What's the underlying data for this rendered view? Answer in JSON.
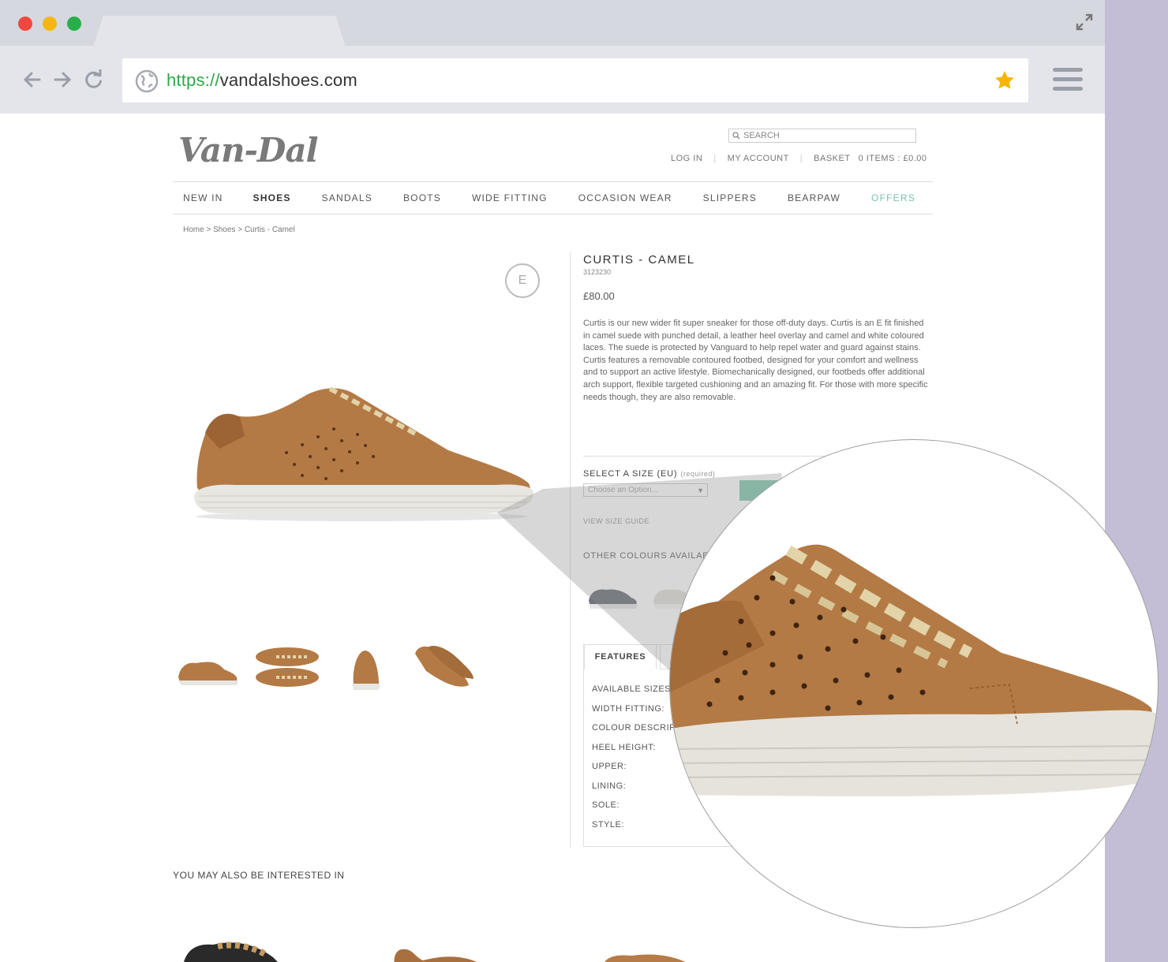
{
  "browser": {
    "url_protocol": "https://",
    "url_host": "vandalshoes.com"
  },
  "header": {
    "logo": "Van-Dal",
    "search_placeholder": "SEARCH",
    "login": "LOG IN",
    "account": "MY ACCOUNT",
    "basket": "BASKET",
    "basket_summary": "0 ITEMS : £0.00"
  },
  "nav": {
    "items": [
      "NEW IN",
      "SHOES",
      "SANDALS",
      "BOOTS",
      "WIDE FITTING",
      "OCCASION WEAR",
      "SLIPPERS",
      "BEARPAW",
      "OFFERS"
    ],
    "active": "SHOES",
    "highlight": "OFFERS",
    "highlight_color": "#7cc3a7"
  },
  "breadcrumb": "Home  >  Shoes  >  Curtis - Camel",
  "product": {
    "fitting_badge": "E",
    "title": "CURTIS - CAMEL",
    "sku": "3123230",
    "price": "£80.00",
    "description": "Curtis is our new wider fit super sneaker for those off-duty days. Curtis is an E fit finished in camel suede with punched detail, a leather heel overlay and camel and white coloured laces. The suede is protected by Vanguard to help repel water and guard against stains. Curtis features a removable contoured footbed, designed for your comfort and wellness and to support an active lifestyle. Biomechanically designed, our footbeds offer additional arch support, flexible targeted cushioning and an amazing fit. For those with more specific needs though, they are also removable.",
    "size_label": "SELECT A SIZE (EU)",
    "size_required": "(required)",
    "size_placeholder": "Choose an Option...",
    "size_guide": "VIEW SIZE GUIDE",
    "other_colours": "OTHER COLOURS AVAILABL",
    "features_tab": "FEATURES",
    "specs": [
      "AVAILABLE SIZES",
      "WIDTH FITTING:",
      "COLOUR DESCRIP",
      "HEEL HEIGHT:",
      "UPPER:",
      "LINING:",
      "SOLE:",
      "STYLE:"
    ],
    "suede_color": "#b37a45",
    "sole_color": "#e8e6e1"
  },
  "related_title": "YOU MAY ALSO BE INTERESTED IN"
}
